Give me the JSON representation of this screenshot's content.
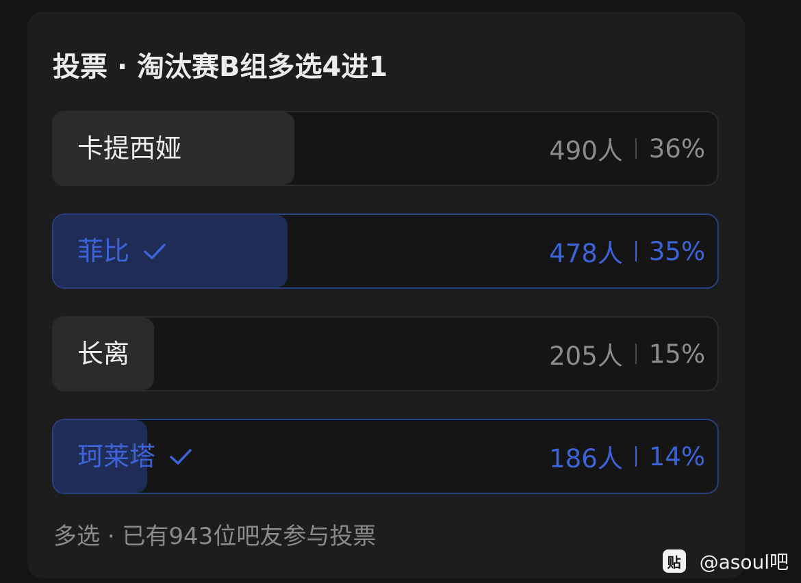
{
  "poll": {
    "title": "投票 · 淘汰赛B组多选4进1",
    "options": [
      {
        "label": "卡提西娅",
        "votes": "490人",
        "percent": "36%",
        "share": 0.36,
        "voted": false
      },
      {
        "label": "菲比",
        "votes": "478人",
        "percent": "35%",
        "share": 0.35,
        "voted": true
      },
      {
        "label": "长离",
        "votes": "205人",
        "percent": "15%",
        "share": 0.15,
        "voted": false
      },
      {
        "label": "珂莱塔",
        "votes": "186人",
        "percent": "14%",
        "share": 0.14,
        "voted": true
      }
    ],
    "footer": "多选 · 已有943位吧友参与投票"
  },
  "watermark": {
    "logo_text": "贴",
    "text": "@asoul吧"
  },
  "colors": {
    "background": "#141414",
    "card": "#1d1d1e",
    "accent": "#3d63d9",
    "voted_fill": "#1f2c56",
    "unvoted_fill": "#2b2b2d"
  }
}
